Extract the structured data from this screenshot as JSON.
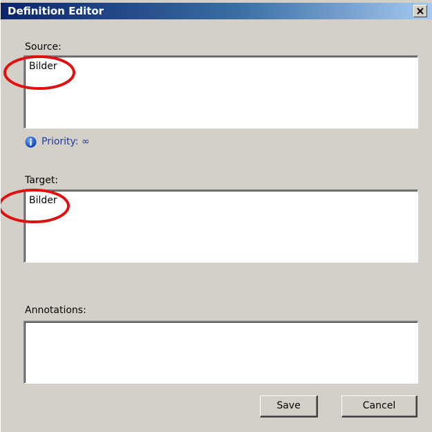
{
  "window": {
    "title": "Definition Editor",
    "close_glyph": "✕",
    "close_icon": "close-icon"
  },
  "source": {
    "label": "Source:",
    "value": "Bilder"
  },
  "priority": {
    "icon": "info-icon",
    "text": "Priority: ∞"
  },
  "target": {
    "label": "Target:",
    "value": "Bilder"
  },
  "annotations": {
    "label": "Annotations:",
    "value": ""
  },
  "buttons": {
    "save": "Save",
    "cancel": "Cancel"
  },
  "colors": {
    "titlebar_start": "#0a246a",
    "titlebar_end": "#a6caf0",
    "dialog_bg": "#d4d0c8",
    "highlight_ring": "#e01010",
    "priority_text": "#1a3ca0"
  }
}
